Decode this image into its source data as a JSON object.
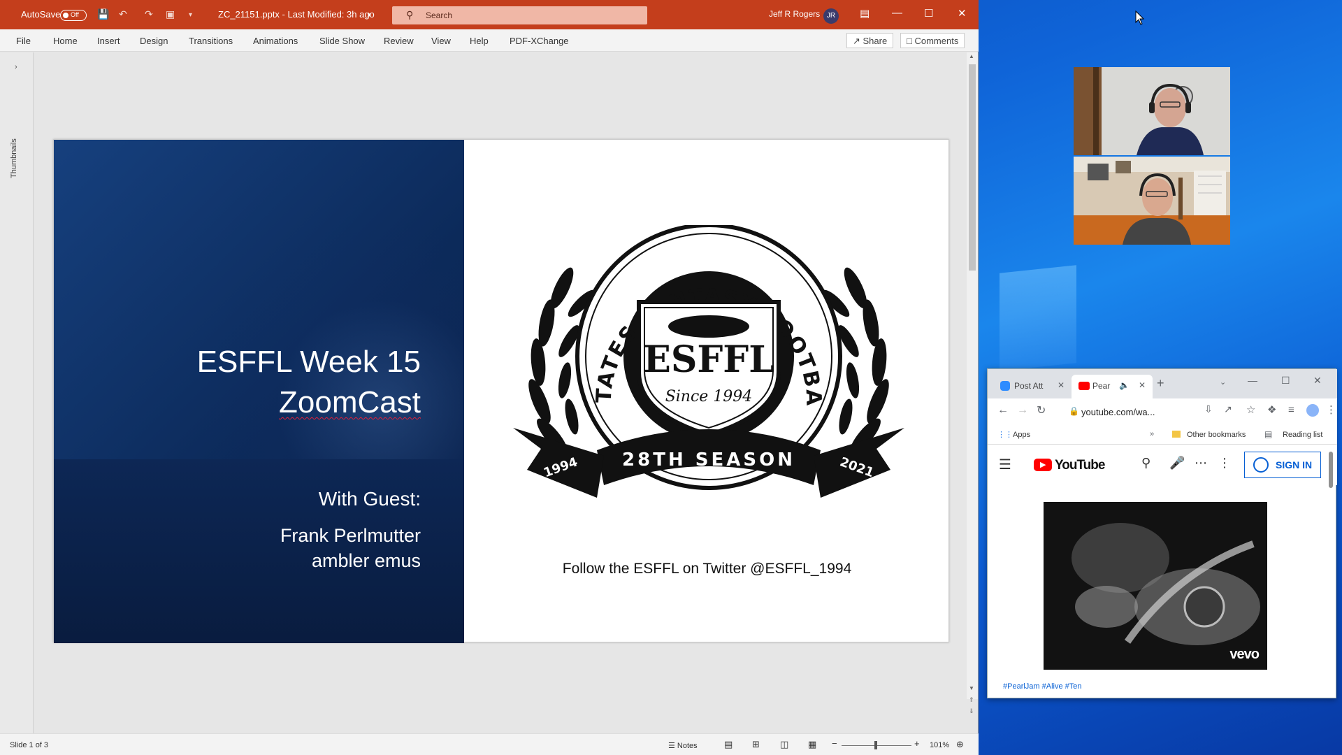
{
  "ppt": {
    "autosave_label": "AutoSave",
    "autosave_state": "Off",
    "doc_title": "ZC_21151.pptx  -  Last Modified: 3h ago",
    "search_placeholder": "Search",
    "user_name": "Jeff R Rogers",
    "user_initials": "JR",
    "tabs": [
      "File",
      "Home",
      "Insert",
      "Design",
      "Transitions",
      "Animations",
      "Slide Show",
      "Review",
      "View",
      "Help",
      "PDF-XChange"
    ],
    "share_label": "Share",
    "comments_label": "Comments",
    "thumbnails_label": "Thumbnails"
  },
  "slide": {
    "title_line1": "ESFFL Week 15",
    "title_line2": "ZoomCast",
    "guest_label": "With Guest:",
    "guest_name1": "Frank Perlmutter",
    "guest_name2": "ambler emus",
    "logo": {
      "arc_text": "EASTERN STATES FANTASY FOOTBALL LEAGUE",
      "abbrev": "ESFFL",
      "since": "Since 1994",
      "season": "28TH SEASON",
      "year_left": "1994",
      "year_right": "2021"
    },
    "follow_text": "Follow the ESFFL on Twitter @ESFFL_1994"
  },
  "status": {
    "slide_count": "Slide 1 of 3",
    "notes_label": "Notes",
    "zoom": "101%"
  },
  "chrome": {
    "tab1": "Post Att",
    "tab2": "Pear",
    "url": "youtube.com/wa...",
    "bookmark_apps": "Apps",
    "bookmark_other": "Other bookmarks",
    "bookmark_reading": "Reading list",
    "youtube_logo": "YouTube",
    "signin": "SIGN IN",
    "video_watermark": "vevo",
    "tags": "#PearlJam #Alive #Ten"
  }
}
